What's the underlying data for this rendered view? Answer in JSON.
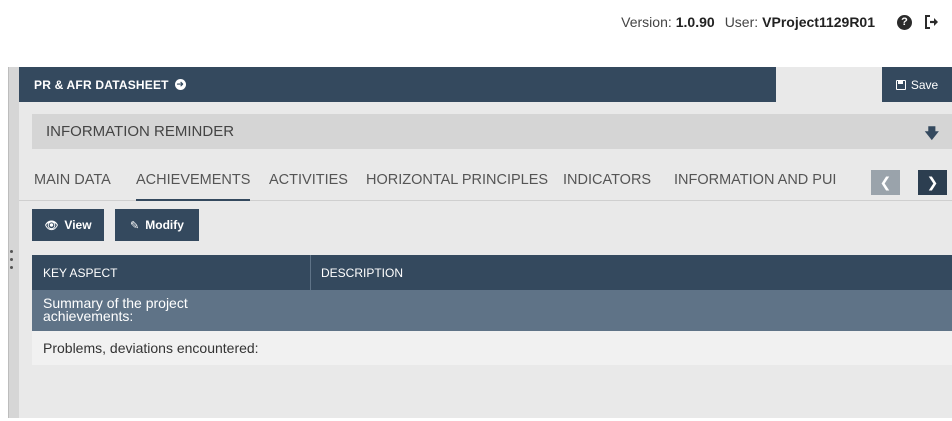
{
  "topbar": {
    "version_label": "Version:",
    "version_value": "1.0.90",
    "user_label": "User:",
    "user_value": "VProject1129R01"
  },
  "header": {
    "title": "PR & AFR DATASHEET",
    "save_label": "Save"
  },
  "reminder": {
    "label": "INFORMATION REMINDER"
  },
  "tabs": [
    {
      "label": "MAIN DATA"
    },
    {
      "label": "ACHIEVEMENTS"
    },
    {
      "label": "ACTIVITIES"
    },
    {
      "label": "HORIZONTAL PRINCIPLES"
    },
    {
      "label": "INDICATORS"
    },
    {
      "label": "INFORMATION AND PUI"
    }
  ],
  "active_tab": "ACHIEVEMENTS",
  "actions": {
    "view_label": "View",
    "modify_label": "Modify"
  },
  "table": {
    "columns": [
      "KEY ASPECT",
      "DESCRIPTION"
    ],
    "rows": [
      {
        "key": "Summary of the project achievements:",
        "description": ""
      },
      {
        "key": "Problems, deviations encountered:",
        "description": ""
      }
    ]
  },
  "colors": {
    "header_bg": "#34495e",
    "summary_row_bg": "#5f7387",
    "panel_bg": "#e9e9e9",
    "reminder_bg": "#d5d5d5"
  },
  "icons": [
    "help-icon",
    "logout-icon",
    "arrow-right-circle-icon",
    "save-icon",
    "arrow-down-icon",
    "chevron-left-icon",
    "chevron-right-icon",
    "eye-icon",
    "pencil-icon"
  ]
}
